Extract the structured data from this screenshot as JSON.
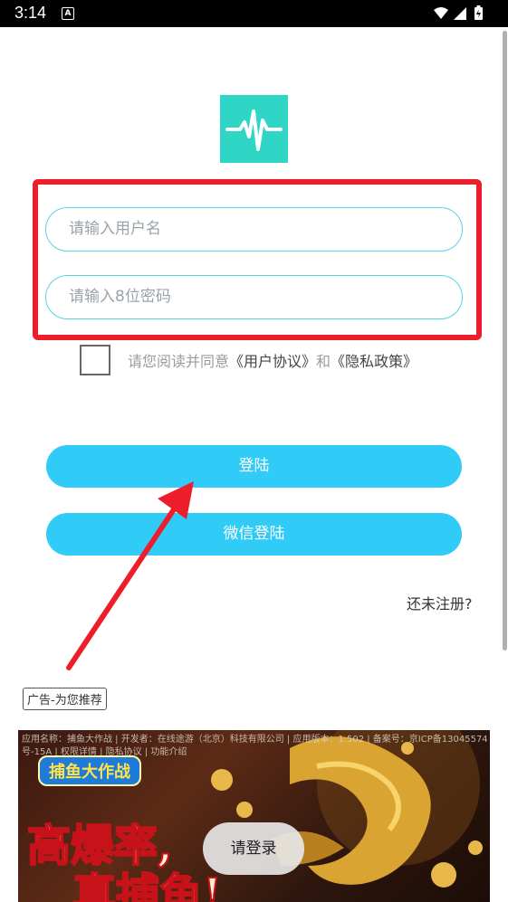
{
  "status_bar": {
    "time": "3:14",
    "notification_badge": "A",
    "icons": [
      "wifi-icon",
      "signal-icon",
      "battery-charging-icon"
    ]
  },
  "logo": {
    "icon": "pulse-waveform-icon",
    "color": "#2fd6c5"
  },
  "form": {
    "username_placeholder": "请输入用户名",
    "password_placeholder": "请输入8位密码"
  },
  "agreement": {
    "prefix": "请您阅读并同意",
    "user_agreement": "《用户协议》",
    "conjunction": "和",
    "privacy_policy": "《隐私政策》"
  },
  "buttons": {
    "login": "登陆",
    "wechat_login": "微信登陆"
  },
  "register_link": "还未注册?",
  "ad": {
    "tag": "广告-为您推荐",
    "info_line1": "应用名称：捕鱼大作战 | 开发者：在线途游（北京）科技有限公司 | 应用版本：1.502 | 备案号：京ICP备13045574",
    "info_line2": "号-15A | 权限详情 | 隐私协议 | 功能介绍",
    "game_title": "捕鱼大作战",
    "slogan_1": "高爆率,",
    "slogan_2": "真捕鱼!"
  },
  "toast": "请登录",
  "colors": {
    "accent": "#31cbf7",
    "field_border": "#5ad2e6",
    "highlight": "#ee1d2b"
  }
}
